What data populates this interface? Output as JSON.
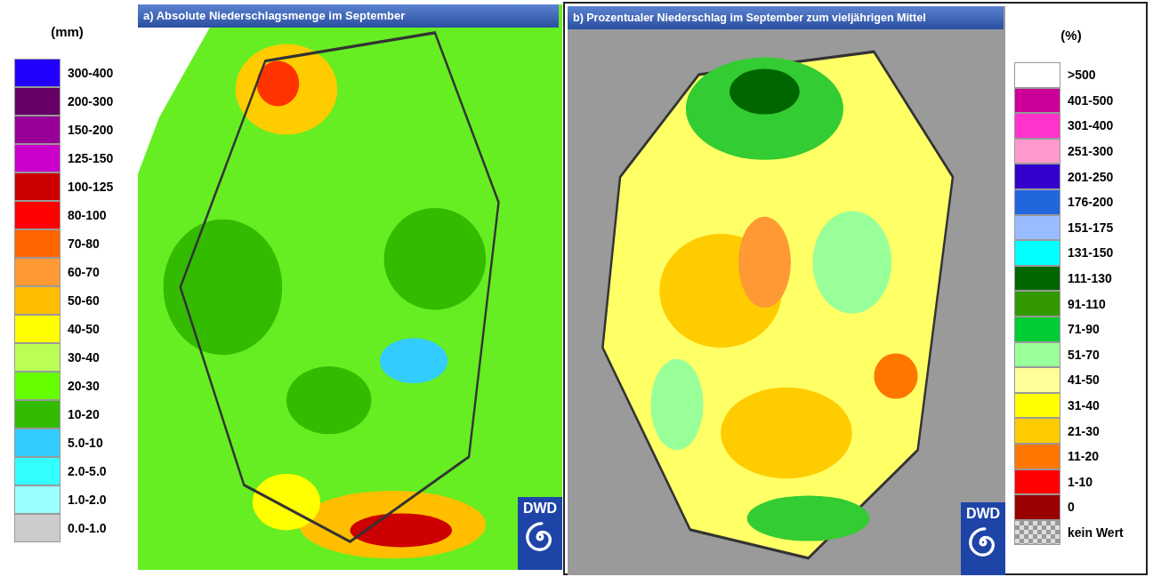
{
  "legend_a": {
    "unit": "(mm)",
    "items": [
      {
        "label": "300-400",
        "color": "#2200ff"
      },
      {
        "label": "200-300",
        "color": "#660066"
      },
      {
        "label": "150-200",
        "color": "#990099"
      },
      {
        "label": "125-150",
        "color": "#cc00cc"
      },
      {
        "label": "100-125",
        "color": "#cc0000"
      },
      {
        "label": "80-100",
        "color": "#ff0000"
      },
      {
        "label": "70-80",
        "color": "#ff6600"
      },
      {
        "label": "60-70",
        "color": "#ff9933"
      },
      {
        "label": "50-60",
        "color": "#ffbf00"
      },
      {
        "label": "40-50",
        "color": "#ffff00"
      },
      {
        "label": "30-40",
        "color": "#bbff55"
      },
      {
        "label": "20-30",
        "color": "#66ff00"
      },
      {
        "label": "10-20",
        "color": "#33bb00"
      },
      {
        "label": "5.0-10",
        "color": "#33ccff"
      },
      {
        "label": "2.0-5.0",
        "color": "#33ffff"
      },
      {
        "label": "1.0-2.0",
        "color": "#99ffff"
      },
      {
        "label": "0.0-1.0",
        "color": "#cccccc"
      }
    ]
  },
  "map_a": {
    "title": "a) Absolute Niederschlagsmenge im September",
    "logo": "DWD"
  },
  "map_b": {
    "title": "b) Prozentualer Niederschlag im September zum vieljährigen Mittel",
    "logo": "DWD"
  },
  "legend_b": {
    "unit": "(%)",
    "items": [
      {
        "label": ">500",
        "kind": "swatch",
        "color": "#ffffff"
      },
      {
        "label": "401-500",
        "kind": "swatch",
        "color": "#cc0099"
      },
      {
        "label": "301-400",
        "kind": "swatch",
        "color": "#ff33cc"
      },
      {
        "label": "251-300",
        "kind": "swatch",
        "color": "#ff99cc"
      },
      {
        "label": "201-250",
        "kind": "swatch",
        "color": "#3300cc"
      },
      {
        "label": "176-200",
        "kind": "swatch",
        "color": "#2266dd"
      },
      {
        "label": "151-175",
        "kind": "swatch",
        "color": "#99bbff"
      },
      {
        "label": "131-150",
        "kind": "swatch",
        "color": "#00ffff"
      },
      {
        "label": "111-130",
        "kind": "swatch",
        "color": "#006600"
      },
      {
        "label": "91-110",
        "kind": "swatch",
        "color": "#339900"
      },
      {
        "label": "71-90",
        "kind": "swatch",
        "color": "#00cc33"
      },
      {
        "label": "51-70",
        "kind": "swatch",
        "color": "#99ff99"
      },
      {
        "label": "41-50",
        "kind": "swatch",
        "color": "#ffff99"
      },
      {
        "label": "31-40",
        "kind": "swatch",
        "color": "#ffff00"
      },
      {
        "label": "21-30",
        "kind": "swatch",
        "color": "#ffcc00"
      },
      {
        "label": "11-20",
        "kind": "swatch",
        "color": "#ff7700"
      },
      {
        "label": "1-10",
        "kind": "swatch",
        "color": "#ff0000"
      },
      {
        "label": "0",
        "kind": "swatch",
        "color": "#990000"
      },
      {
        "label": "kein Wert",
        "kind": "pattern"
      }
    ]
  }
}
